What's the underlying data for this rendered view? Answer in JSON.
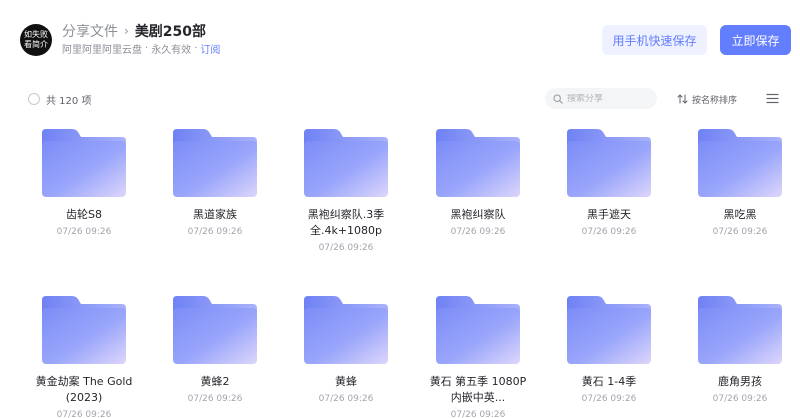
{
  "header": {
    "avatar_lines": [
      "如失败",
      "看简介"
    ],
    "breadcrumb_root": "分享文件",
    "breadcrumb_sep": "›",
    "title": "美剧250部",
    "source": "阿里阿里阿里云盘",
    "validity": "永久有效",
    "subscribe": "订阅",
    "phone_save_label": "用手机快速保存",
    "save_label": "立即保存"
  },
  "toolbar": {
    "count_label": "共 120 项",
    "search_placeholder": "搜索分享",
    "sort_label": "按名称排序"
  },
  "colors": {
    "accent": "#637dff",
    "accent_light": "#eef1ff"
  },
  "items": [
    {
      "name": "齿轮S8",
      "date": "07/26 09:26"
    },
    {
      "name": "黑道家族",
      "date": "07/26 09:26"
    },
    {
      "name": "黑袍纠察队.3季全.4k+1080p",
      "date": "07/26 09:26"
    },
    {
      "name": "黑袍纠察队",
      "date": "07/26 09:26"
    },
    {
      "name": "黑手遮天",
      "date": "07/26 09:26"
    },
    {
      "name": "黑吃黑",
      "date": "07/26 09:26"
    },
    {
      "name": "黄金劫案 The Gold (2023)",
      "date": "07/26 09:26"
    },
    {
      "name": "黄蜂2",
      "date": "07/26 09:26"
    },
    {
      "name": "黄蜂",
      "date": "07/26 09:26"
    },
    {
      "name": "黄石 第五季 1080P 内嵌中英...",
      "date": "07/26 09:26"
    },
    {
      "name": "黄石 1-4季",
      "date": "07/26 09:26"
    },
    {
      "name": "鹿角男孩",
      "date": "07/26 09:26"
    }
  ]
}
